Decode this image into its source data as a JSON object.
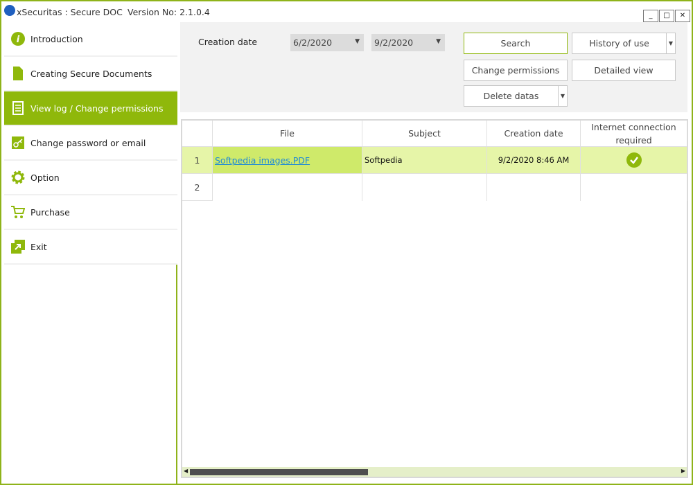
{
  "window": {
    "title": "xSecuritas : Secure DOC",
    "version": "Version No: 2.1.0.4",
    "controls": [
      "_",
      "□",
      "✕"
    ]
  },
  "sidebar": {
    "items": [
      {
        "label": "Introduction",
        "icon": "info-icon"
      },
      {
        "label": "Creating Secure Documents",
        "icon": "document-icon"
      },
      {
        "label": "View log / Change permissions",
        "icon": "scroll-icon",
        "active": true
      },
      {
        "label": "Change password or email",
        "icon": "key-icon"
      },
      {
        "label": "Option",
        "icon": "gear-icon"
      },
      {
        "label": "Purchase",
        "icon": "cart-icon"
      },
      {
        "label": "Exit",
        "icon": "exit-icon"
      }
    ]
  },
  "filter": {
    "creation_label": "Creation date",
    "date_from": "6/2/2020",
    "date_to": "9/2/2020",
    "search": "Search",
    "history": "History of use",
    "change_permissions": "Change permissions",
    "detailed_view": "Detailed view",
    "delete": "Delete datas"
  },
  "grid": {
    "columns": [
      "",
      "File",
      "Subject",
      "Creation date",
      "Internet connection required"
    ],
    "rows": [
      {
        "num": "1",
        "file": "Softpedia images.PDF",
        "subject": "Softpedia",
        "date": "9/2/2020 8:46 AM",
        "internet": true
      },
      {
        "num": "2",
        "file": "",
        "subject": "",
        "date": "",
        "internet": false
      }
    ]
  },
  "colors": {
    "accent": "#8fb80b",
    "row_selected": "#e6f5a8",
    "cell_selected": "#cfea6a"
  }
}
